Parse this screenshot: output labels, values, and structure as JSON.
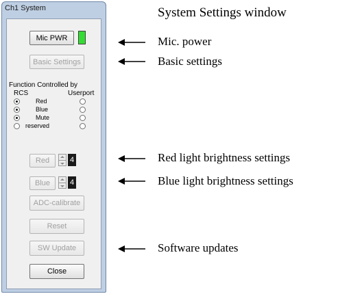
{
  "window": {
    "title": "Ch1  System"
  },
  "led_color": "#33dd33",
  "buttons": {
    "mic_pwr": "Mic PWR",
    "basic_settings": "Basic Settings",
    "adc_calibrate": "ADC-calibrate",
    "reset": "Reset",
    "sw_update": "SW Update",
    "close": "Close"
  },
  "function_group": {
    "title": "Function Controlled by",
    "col_left": "RCS",
    "col_right": "Userport",
    "rows": [
      {
        "label": "Red",
        "rcs": true,
        "userport": false
      },
      {
        "label": "Blue",
        "rcs": true,
        "userport": false
      },
      {
        "label": "Mute",
        "rcs": true,
        "userport": false
      },
      {
        "label": "reserved",
        "rcs": false,
        "userport": false
      }
    ]
  },
  "red_brightness": {
    "label": "Red",
    "value": "4"
  },
  "blue_brightness": {
    "label": "Blue",
    "value": "4"
  },
  "annotations": {
    "heading": "System Settings window",
    "mic_power": "Mic. power",
    "basic_settings": "Basic settings",
    "red_light": "Red light brightness settings",
    "blue_light": "Blue light brightness settings",
    "software_updates": "Software updates"
  }
}
